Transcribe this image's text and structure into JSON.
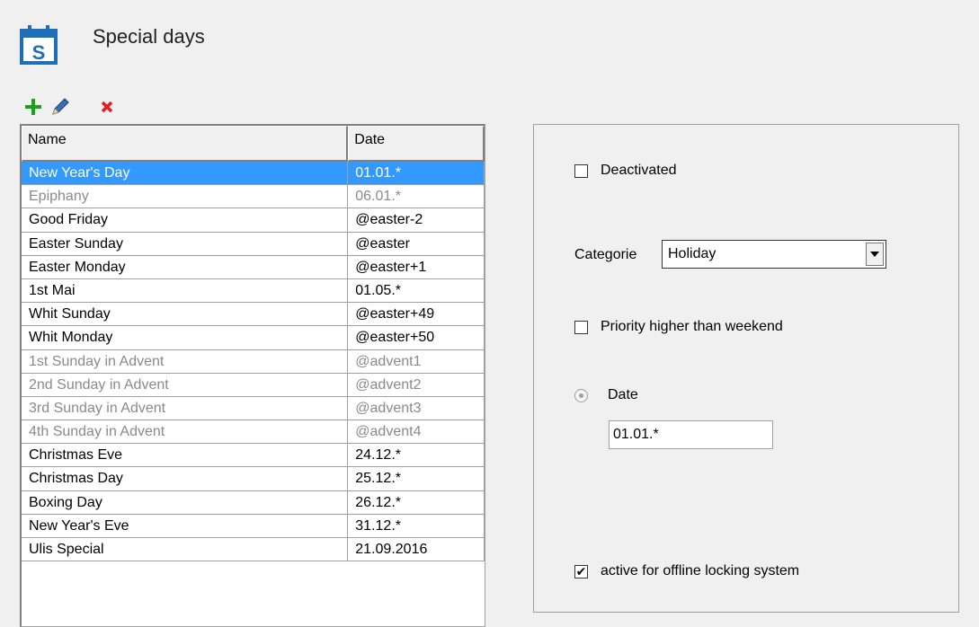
{
  "header": {
    "title": "Special days",
    "icon_letter": "S"
  },
  "toolbar": {
    "add": "plus-icon",
    "edit": "pencil-icon",
    "delete": "delete-icon"
  },
  "list": {
    "columns": {
      "name": "Name",
      "date": "Date"
    },
    "rows": [
      {
        "name": "New Year's Day",
        "date": "01.01.*",
        "state": "selected"
      },
      {
        "name": "Epiphany",
        "date": "06.01.*",
        "state": "muted"
      },
      {
        "name": "Good Friday",
        "date": "@easter-2",
        "state": "normal"
      },
      {
        "name": "Easter Sunday",
        "date": "@easter",
        "state": "normal"
      },
      {
        "name": "Easter Monday",
        "date": "@easter+1",
        "state": "normal"
      },
      {
        "name": "1st Mai",
        "date": "01.05.*",
        "state": "normal"
      },
      {
        "name": "Whit Sunday",
        "date": "@easter+49",
        "state": "normal"
      },
      {
        "name": "Whit Monday",
        "date": "@easter+50",
        "state": "normal"
      },
      {
        "name": "1st Sunday in Advent",
        "date": "@advent1",
        "state": "muted"
      },
      {
        "name": "2nd Sunday in Advent",
        "date": "@advent2",
        "state": "muted"
      },
      {
        "name": "3rd Sunday in Advent",
        "date": "@advent3",
        "state": "muted"
      },
      {
        "name": "4th Sunday in Advent",
        "date": "@advent4",
        "state": "muted"
      },
      {
        "name": "Christmas Eve",
        "date": "24.12.*",
        "state": "normal"
      },
      {
        "name": "Christmas Day",
        "date": "25.12.*",
        "state": "normal"
      },
      {
        "name": "Boxing Day",
        "date": "26.12.*",
        "state": "normal"
      },
      {
        "name": "New Year's Eve",
        "date": "31.12.*",
        "state": "normal"
      },
      {
        "name": "Ulis Special",
        "date": "21.09.2016",
        "state": "normal"
      }
    ]
  },
  "details": {
    "deactivated": {
      "label": "Deactivated",
      "checked": false
    },
    "category": {
      "label": "Categorie",
      "value": "Holiday"
    },
    "priority": {
      "label": "Priority higher than weekend",
      "checked": false
    },
    "date_radio": {
      "label": "Date",
      "selected": true
    },
    "date_value": "01.01.*",
    "offline": {
      "label": "active for offline locking system",
      "checked": true
    }
  },
  "colors": {
    "selection": "#3399ff",
    "muted_text": "#8a8a8a",
    "icon_blue": "#1e6fb8"
  }
}
